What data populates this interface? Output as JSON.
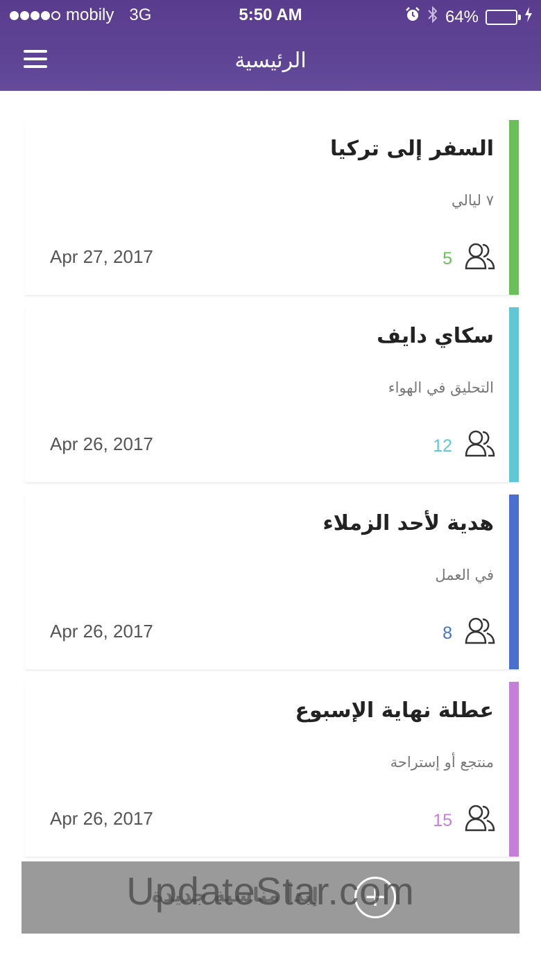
{
  "status_bar": {
    "carrier": "mobily",
    "network": "3G",
    "time": "5:50 AM",
    "battery": "64%",
    "battery_level": 0.64,
    "signal_bars_filled": 4,
    "signal_bars_total": 5,
    "icons": [
      "alarm-icon",
      "bluetooth-icon",
      "battery-icon",
      "charging-icon"
    ]
  },
  "nav": {
    "title": "الرئيسية",
    "menu_icon": "hamburger-menu-icon"
  },
  "events": [
    {
      "title": "السفر إلى تركيا",
      "subtitle": "٧ ليالي",
      "count": "5",
      "date": "Apr 27, 2017",
      "color": "#6bbf59"
    },
    {
      "title": "سكاي دايف",
      "subtitle": "التحليق في الهواء",
      "count": "12",
      "date": "Apr 26, 2017",
      "color": "#5ec8d6"
    },
    {
      "title": "هدية لأحد الزملاء",
      "subtitle": "في العمل",
      "count": "8",
      "date": "Apr 26, 2017",
      "color": "#4a6fd0"
    },
    {
      "title": "عطلة نهاية الإسبوع",
      "subtitle": "منتجع أو إستراحة",
      "count": "15",
      "date": "Apr 26, 2017",
      "color": "#c57fd8"
    }
  ],
  "add_button": {
    "label": "إبدأ مناسبة جديدة",
    "icon": "plus-icon",
    "symbol": "+"
  },
  "watermark": "UpdateStar.com",
  "colors": {
    "header": "#5e4395",
    "add_button_bg": "#9a9a9a"
  }
}
